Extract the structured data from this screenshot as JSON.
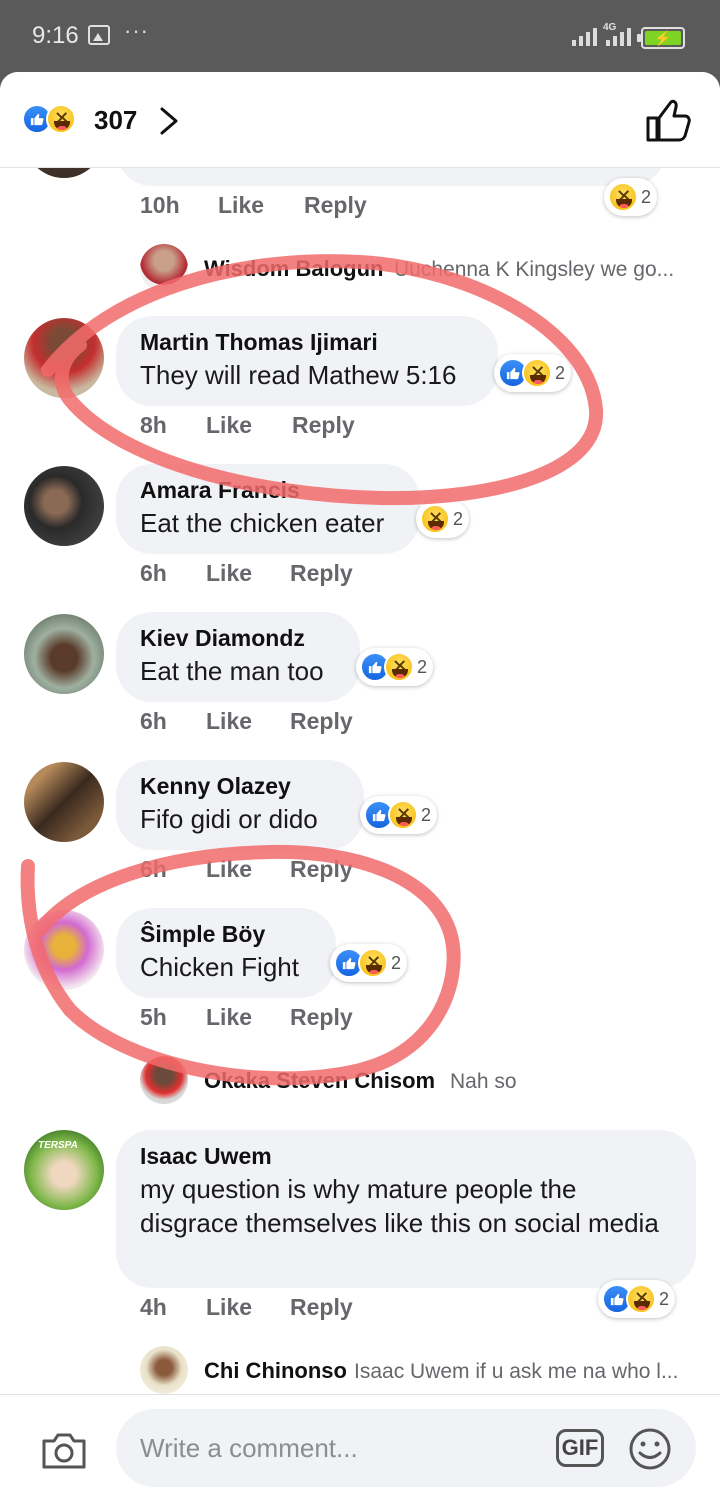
{
  "status_bar": {
    "time": "9:16",
    "more": "···",
    "network": "4G"
  },
  "header": {
    "reaction_count": "307"
  },
  "comments": [
    {
      "id": "partial",
      "time": "10h",
      "like": "Like",
      "reply": "Reply",
      "reactions_count": "2"
    },
    {
      "id": "reply-wisdom",
      "name": "Wisdom Balogun",
      "snippet": "Uuchenna K Kingsley we go..."
    },
    {
      "id": "martin",
      "name": "Martin Thomas Ijimari",
      "text": "They will read Mathew 5:16",
      "time": "8h",
      "like": "Like",
      "reply": "Reply",
      "reactions_count": "2"
    },
    {
      "id": "amara",
      "name": "Amara Francis",
      "text": "Eat the chicken eater",
      "time": "6h",
      "like": "Like",
      "reply": "Reply",
      "reactions_count": "2"
    },
    {
      "id": "kiev",
      "name": "Kiev Diamondz",
      "text": "Eat the man too",
      "time": "6h",
      "like": "Like",
      "reply": "Reply",
      "reactions_count": "2"
    },
    {
      "id": "kenny",
      "name": "Kenny Olazey",
      "text": "Fifo gidi or dido",
      "time": "6h",
      "like": "Like",
      "reply": "Reply",
      "reactions_count": "2"
    },
    {
      "id": "simple",
      "name": "Ŝimple Böy",
      "text": "Chicken Fight",
      "time": "5h",
      "like": "Like",
      "reply": "Reply",
      "reactions_count": "2"
    },
    {
      "id": "reply-okaka",
      "name": "Okaka Steven Chisom",
      "snippet": "Nah so"
    },
    {
      "id": "isaac",
      "name": "Isaac Uwem",
      "text": "my question is why mature people the disgrace themselves like this on social media",
      "time": "4h",
      "like": "Like",
      "reply": "Reply",
      "reactions_count": "2",
      "avatar_text": "TERSPA"
    },
    {
      "id": "reply-chi",
      "name": "Chi Chinonso",
      "snippet": "Isaac Uwem if u ask me na who l..."
    }
  ],
  "composer": {
    "placeholder": "Write a comment...",
    "gif_label": "GIF"
  },
  "colors": {
    "like_blue": "#1877f2",
    "bubble_bg": "#f0f2f5",
    "annotation_red": "#f26b6b"
  }
}
